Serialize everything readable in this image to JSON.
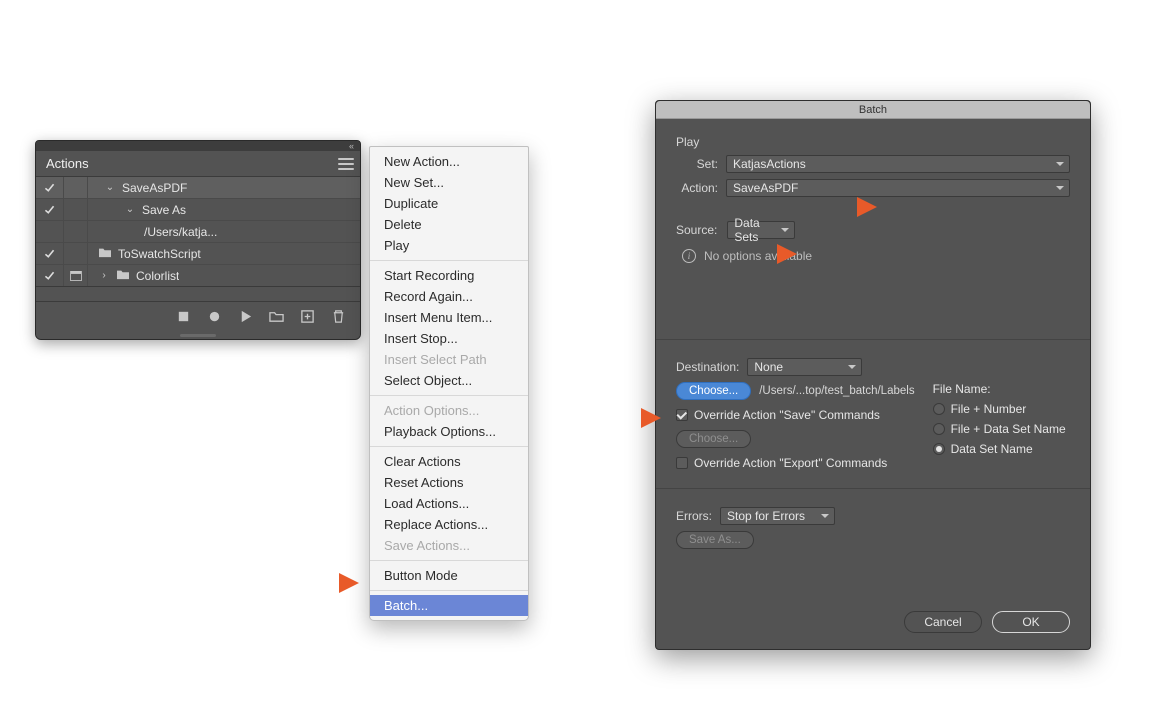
{
  "actions_panel": {
    "title": "Actions",
    "collapse_glyph": "«",
    "rows": [
      {
        "label": "SaveAsPDF",
        "indent": 1,
        "caret": "down",
        "checked": true,
        "dialog": false,
        "folder": false
      },
      {
        "label": "Save As",
        "indent": 2,
        "caret": "down",
        "checked": true,
        "dialog": false,
        "folder": false
      },
      {
        "label": "/Users/katja...",
        "indent": 3,
        "caret": "",
        "checked": null,
        "dialog": null,
        "folder": false
      },
      {
        "label": "ToSwatchScript",
        "indent": 0,
        "caret": "",
        "checked": true,
        "dialog": false,
        "folder": true
      },
      {
        "label": "Colorlist",
        "indent": 0,
        "caret": "right",
        "checked": true,
        "dialog": true,
        "folder": true
      }
    ],
    "toolbar": [
      "stop-icon",
      "record-icon",
      "play-icon",
      "folder-icon",
      "new-icon",
      "trash-icon"
    ]
  },
  "contextmenu": {
    "groups": [
      [
        "New Action...",
        "New Set...",
        "Duplicate",
        "Delete",
        "Play"
      ],
      [
        "Start Recording",
        "Record Again...",
        "Insert Menu Item...",
        "Insert Stop...",
        "__disabled:Insert Select Path",
        "Select Object..."
      ],
      [
        "__disabled:Action Options...",
        "Playback Options..."
      ],
      [
        "Clear Actions",
        "Reset Actions",
        "Load Actions...",
        "Replace Actions...",
        "__disabled:Save Actions..."
      ],
      [
        "Button Mode"
      ],
      [
        "__highlight:Batch..."
      ]
    ]
  },
  "batch": {
    "title": "Batch",
    "play_label": "Play",
    "set_label": "Set:",
    "set_value": "KatjasActions",
    "action_label": "Action:",
    "action_value": "SaveAsPDF",
    "source_label": "Source:",
    "source_value": "Data Sets",
    "no_options": "No options available",
    "destination_label": "Destination:",
    "destination_value": "None",
    "choose_label": "Choose...",
    "choose_path": "/Users/...top/test_batch/Labels",
    "override_save": "Override Action \"Save\" Commands",
    "override_save_checked": true,
    "choose2_label": "Choose...",
    "override_export": "Override Action \"Export\" Commands",
    "override_export_checked": false,
    "filename_label": "File Name:",
    "filename_options": [
      "File + Number",
      "File + Data Set Name",
      "Data Set Name"
    ],
    "filename_selected": 2,
    "errors_label": "Errors:",
    "errors_value": "Stop for Errors",
    "saveas_label": "Save As...",
    "cancel": "Cancel",
    "ok": "OK"
  }
}
